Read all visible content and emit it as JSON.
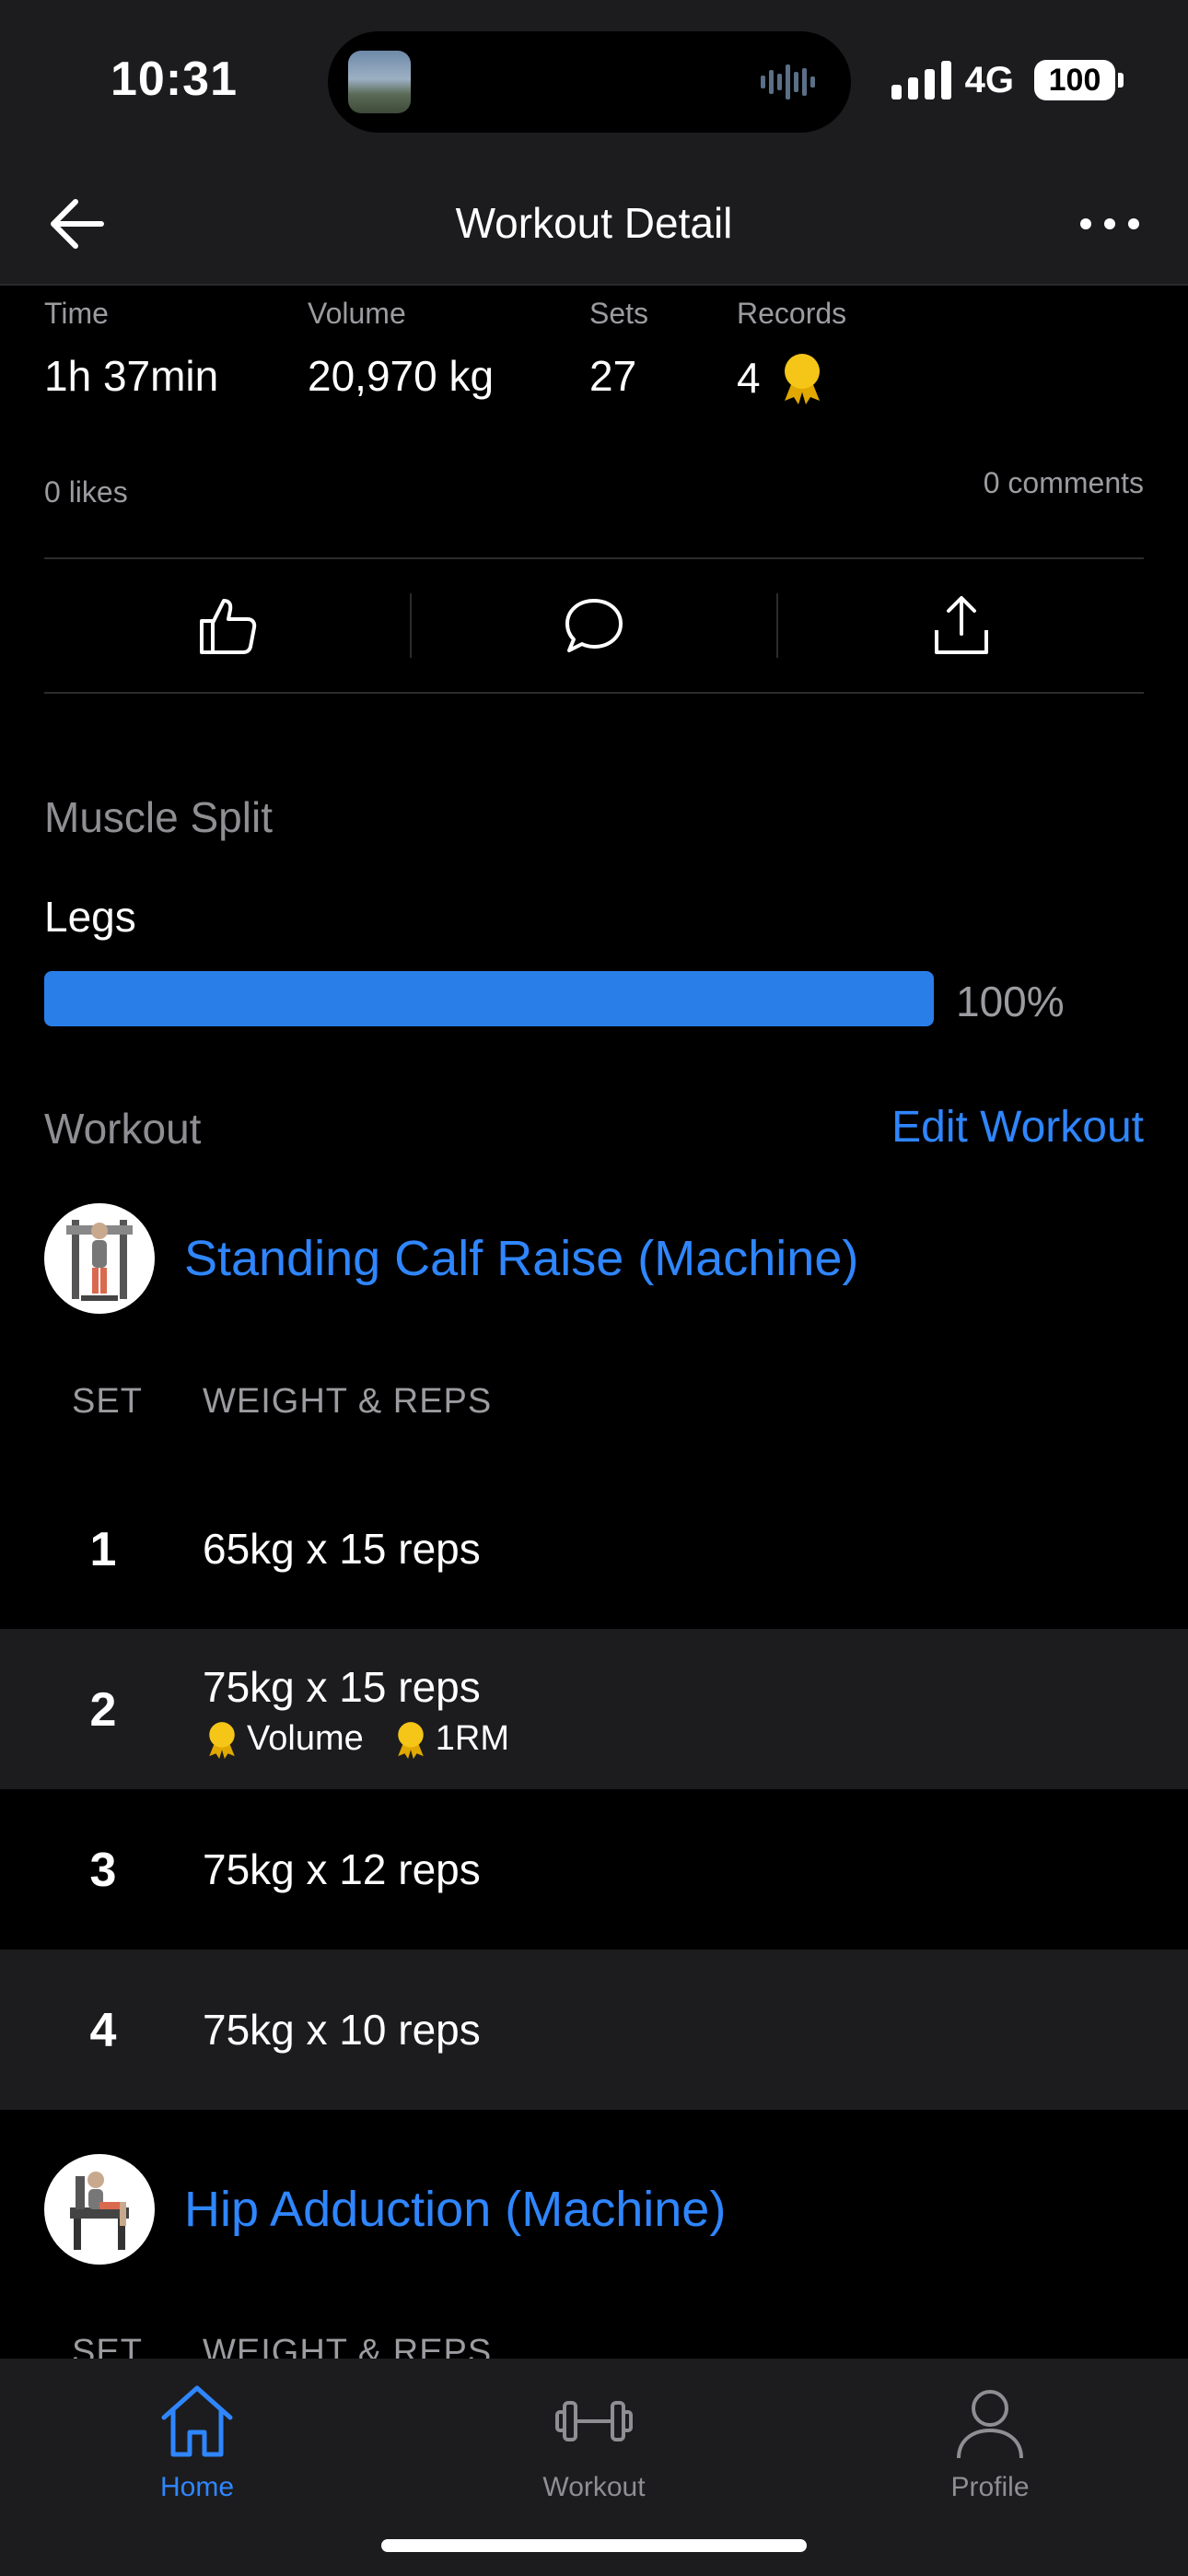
{
  "status_bar": {
    "time": "10:31",
    "network": "4G",
    "battery": "100"
  },
  "nav": {
    "title": "Workout Detail",
    "back_icon": "arrow-left-icon",
    "more_icon": "ellipsis-icon"
  },
  "stats": [
    {
      "label": "Time",
      "value": "1h 37min"
    },
    {
      "label": "Volume",
      "value": "20,970 kg"
    },
    {
      "label": "Sets",
      "value": "27"
    },
    {
      "label": "Records",
      "value": "4"
    }
  ],
  "social": {
    "likes": "0 likes",
    "comments": "0 comments"
  },
  "actions": [
    "like-icon",
    "comment-icon",
    "share-icon"
  ],
  "muscle_split": {
    "title": "Muscle Split",
    "items": [
      {
        "label": "Legs",
        "percent_text": "100%",
        "fraction": 1.0
      }
    ]
  },
  "workout": {
    "title": "Workout",
    "edit_label": "Edit Workout",
    "col_set": "SET",
    "col_weight_reps": "WEIGHT & REPS",
    "exercises": [
      {
        "name": "Standing Calf Raise (Machine)",
        "sets": [
          {
            "num": "1",
            "value": "65kg x 15 reps"
          },
          {
            "num": "2",
            "value": "75kg x 15 reps",
            "prs": [
              "Volume",
              "1RM"
            ]
          },
          {
            "num": "3",
            "value": "75kg x 12 reps"
          },
          {
            "num": "4",
            "value": "75kg x 10 reps"
          }
        ]
      },
      {
        "name": "Hip Adduction (Machine)"
      }
    ]
  },
  "tab_bar": {
    "tabs": [
      {
        "label": "Home",
        "icon": "home-icon",
        "active": true
      },
      {
        "label": "Workout",
        "icon": "dumbbell-icon",
        "active": false
      },
      {
        "label": "Profile",
        "icon": "person-icon",
        "active": false
      }
    ]
  },
  "colors": {
    "accent": "#2f86ff",
    "bar_fill": "#2a7ee8",
    "medal": "#f5c518",
    "surface": "#1c1c1e"
  }
}
